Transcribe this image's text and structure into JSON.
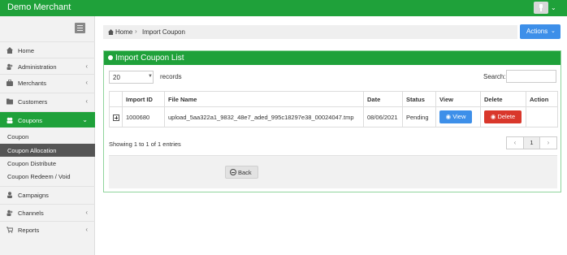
{
  "topbar": {
    "brand": "Demo Merchant"
  },
  "sidebar": {
    "items": [
      {
        "label": "Home",
        "icon": "home-icon"
      },
      {
        "label": "Administration",
        "icon": "users-icon",
        "chevron": "‹"
      },
      {
        "label": "Merchants",
        "icon": "briefcase-icon",
        "chevron": "‹"
      },
      {
        "label": "Customers",
        "icon": "folder-icon",
        "chevron": "‹"
      },
      {
        "label": "Coupons",
        "icon": "coupons-icon",
        "chevron": "⌄",
        "active": true
      },
      {
        "label": "Campaigns",
        "icon": "user-icon"
      },
      {
        "label": "Channels",
        "icon": "users-icon",
        "chevron": "‹"
      },
      {
        "label": "Reports",
        "icon": "cart-icon",
        "chevron": "‹"
      }
    ],
    "sub_items": [
      {
        "label": "Coupon"
      },
      {
        "label": "Coupon Allocation",
        "selected": true
      },
      {
        "label": "Coupon Distribute"
      },
      {
        "label": "Coupon Redeem / Void"
      }
    ]
  },
  "breadcrumb": {
    "home": "Home",
    "current": "Import Coupon"
  },
  "actions": {
    "label": "Actions"
  },
  "panel": {
    "title": "Import Coupon List",
    "length_value": "20",
    "records_label": "records",
    "search_label": "Search:",
    "search_value": "",
    "columns": [
      "Import ID",
      "File Name",
      "Date",
      "Status",
      "View",
      "Delete",
      "Action"
    ],
    "rows": [
      {
        "import_id": "1000680",
        "file_name": "upload_5aa322a1_9832_48e7_aded_995c18297e38_00024047.tmp",
        "date": "08/06/2021",
        "status": "Pending",
        "view_label": "View",
        "delete_label": "Delete",
        "action": ""
      }
    ],
    "info": "Showing 1 to 1 of 1 entries",
    "pager": {
      "prev": "‹",
      "page": "1",
      "next": "›"
    },
    "back_label": "Back"
  },
  "colors": {
    "brand_green": "#1fa13a",
    "primary_blue": "#3d8fe9",
    "danger_red": "#d9372b"
  }
}
